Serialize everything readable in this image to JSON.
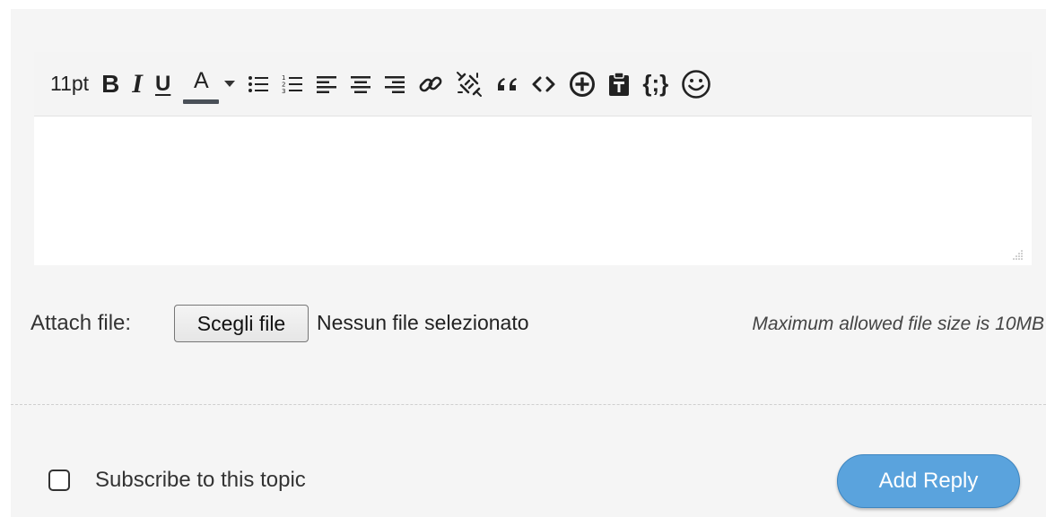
{
  "toolbar": {
    "font_size": "11pt",
    "bold": "B",
    "italic": "I",
    "underline": "U",
    "text_color_letter": "A",
    "text_color_bar": "#4a5058",
    "emoticon_braces": "{;}",
    "icons": [
      "font-size",
      "bold",
      "italic",
      "underline",
      "text-color",
      "dropdown",
      "bullet-list",
      "numbered-list",
      "align-left",
      "align-center",
      "align-right",
      "link",
      "unlink",
      "quote",
      "code",
      "insert",
      "paste",
      "code-block",
      "smiley"
    ]
  },
  "attach": {
    "label": "Attach file:",
    "button_label": "Scegli file",
    "status": "Nessun file selezionato",
    "max_size_note": "Maximum allowed file size is 10MB"
  },
  "subscribe": {
    "label": "Subscribe to this topic",
    "checked": false
  },
  "reply_button": {
    "label": "Add Reply",
    "color": "#5aa3dd"
  }
}
